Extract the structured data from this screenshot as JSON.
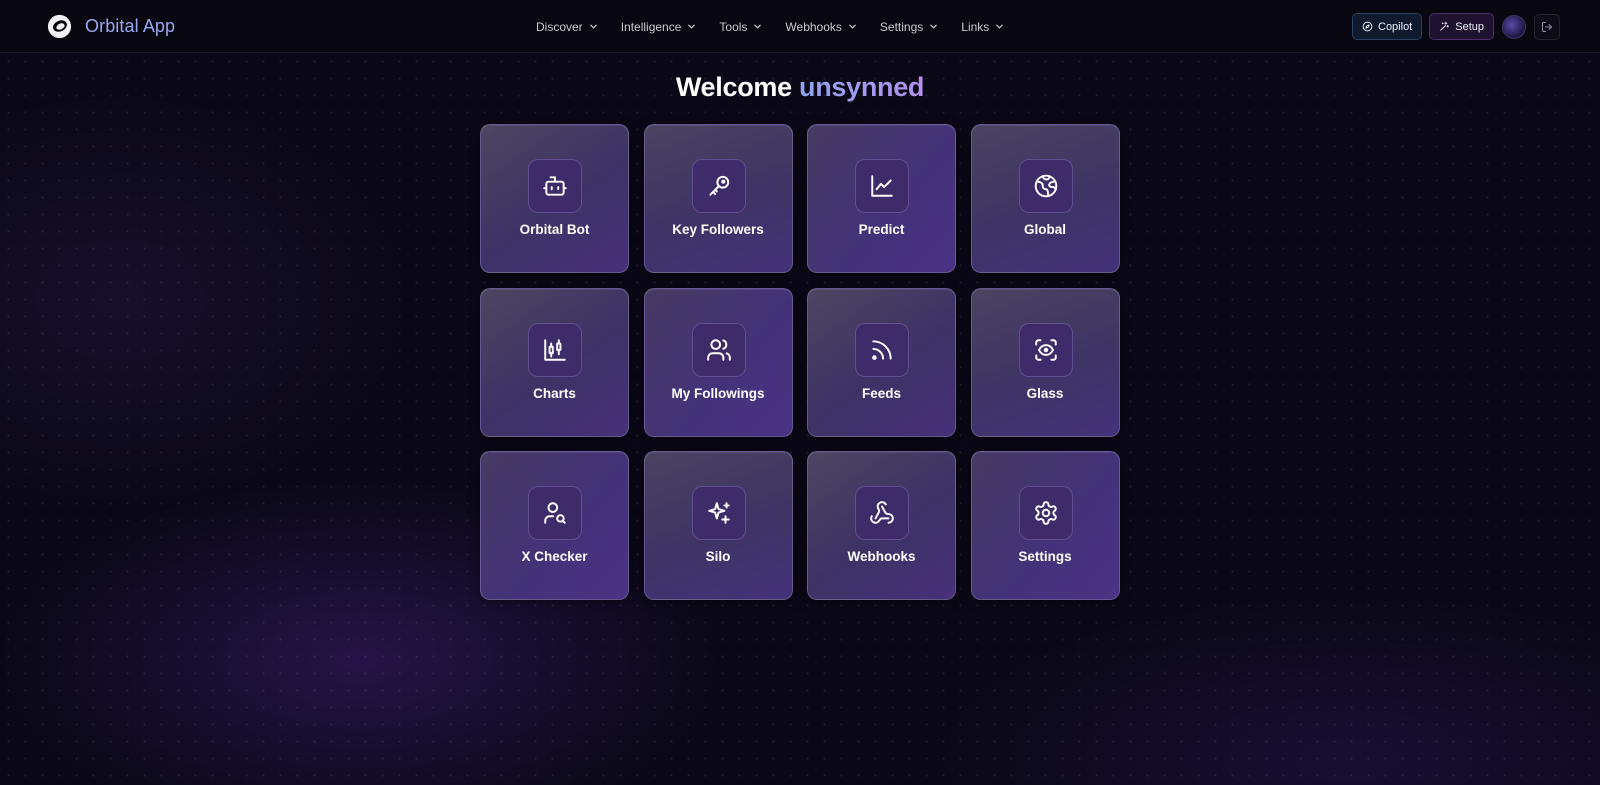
{
  "header": {
    "app_name": "Orbital App",
    "nav": [
      {
        "label": "Discover"
      },
      {
        "label": "Intelligence"
      },
      {
        "label": "Tools"
      },
      {
        "label": "Webhooks"
      },
      {
        "label": "Settings"
      },
      {
        "label": "Links"
      }
    ],
    "copilot_label": "Copilot",
    "setup_label": "Setup"
  },
  "welcome": {
    "greeting": "Welcome",
    "username": "unsynned"
  },
  "tiles": [
    {
      "label": "Orbital Bot",
      "icon": "bot-icon"
    },
    {
      "label": "Key Followers",
      "icon": "key-icon"
    },
    {
      "label": "Predict",
      "icon": "line-chart-icon"
    },
    {
      "label": "Global",
      "icon": "globe-icon"
    },
    {
      "label": "Charts",
      "icon": "candlestick-chart-icon"
    },
    {
      "label": "My Followings",
      "icon": "users-icon"
    },
    {
      "label": "Feeds",
      "icon": "rss-icon"
    },
    {
      "label": "Glass",
      "icon": "scan-eye-icon"
    },
    {
      "label": "X Checker",
      "icon": "user-search-icon"
    },
    {
      "label": "Silo",
      "icon": "sparkles-icon"
    },
    {
      "label": "Webhooks",
      "icon": "webhook-icon"
    },
    {
      "label": "Settings",
      "icon": "gear-icon"
    }
  ],
  "colors": {
    "background": "#0a0816",
    "brand_text": "#9aa6f2",
    "tile_icon_bg": "#3e2b69",
    "accent_gradient_start": "#8fa3ef",
    "accent_gradient_end": "#b590f0"
  }
}
